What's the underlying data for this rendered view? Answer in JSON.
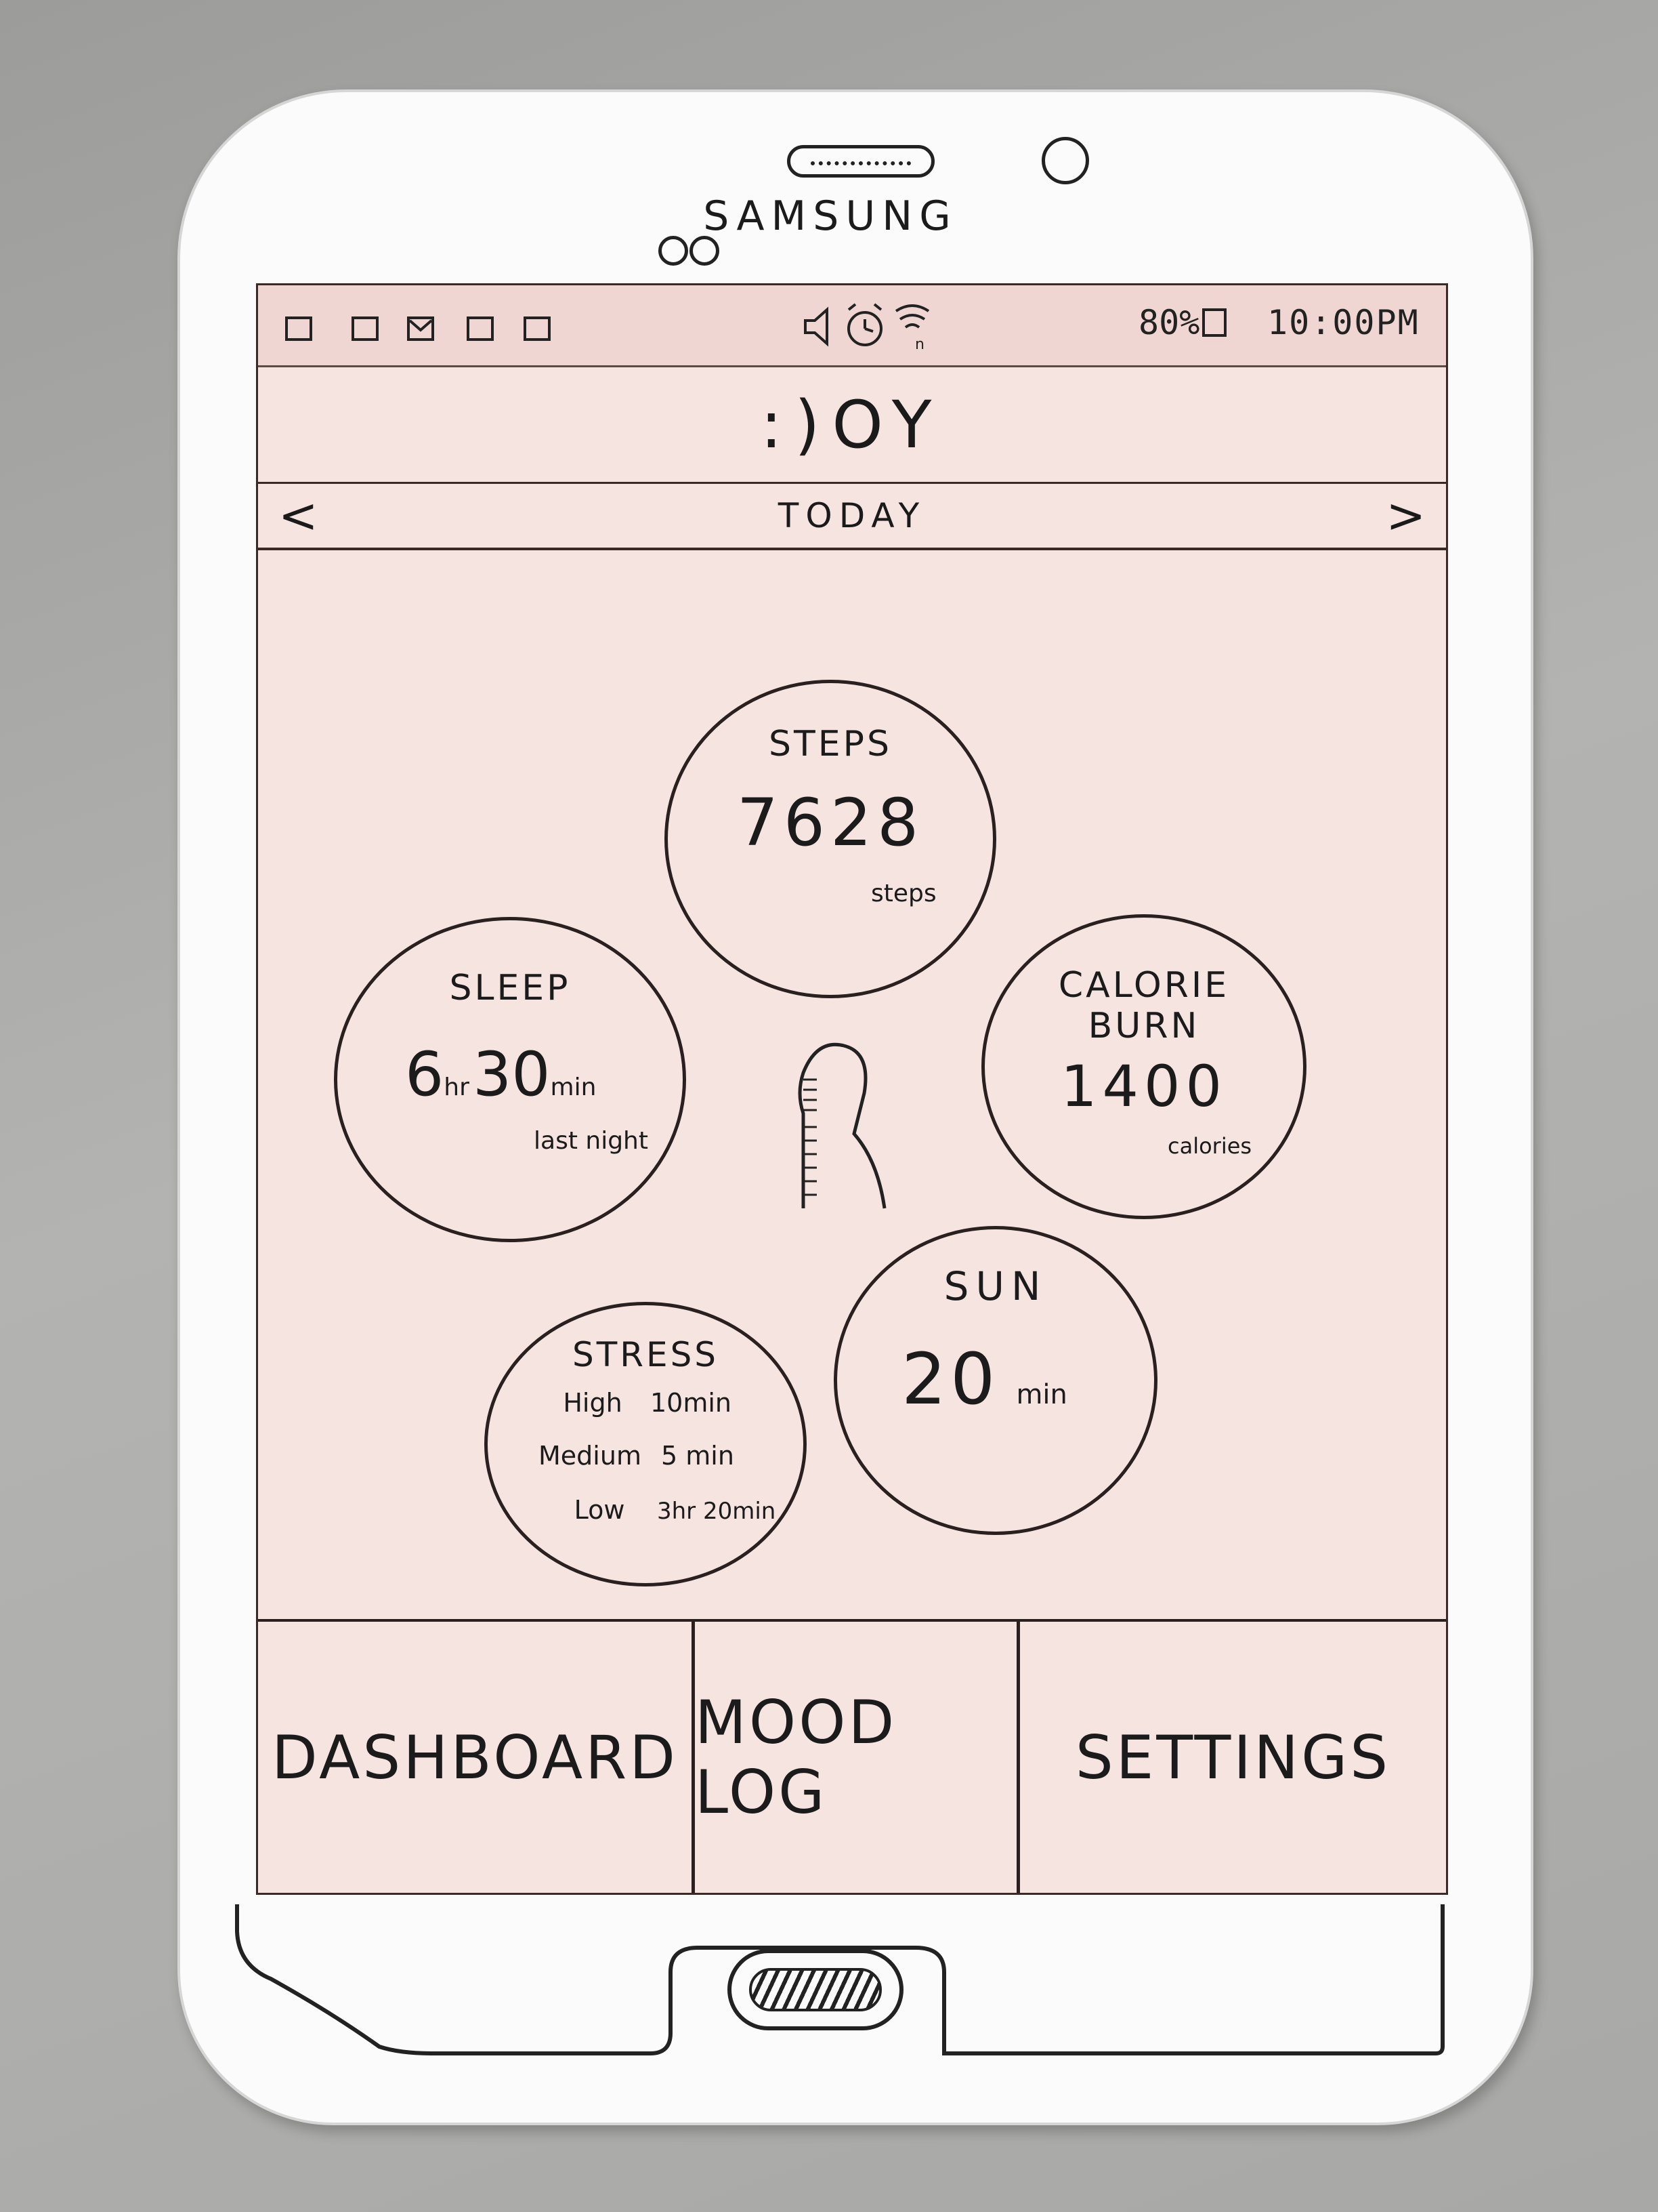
{
  "device": {
    "brand": "SAMSUNG"
  },
  "status_bar": {
    "left_icons": [
      "notification-square-icon",
      "notification-square-icon",
      "mail-icon",
      "notification-square-icon",
      "notification-square-icon"
    ],
    "center_icons": [
      "speaker-icon",
      "alarm-icon",
      "wifi-icon"
    ],
    "battery": "80%",
    "time": "10:00PM"
  },
  "app": {
    "title": ":)OY"
  },
  "date_nav": {
    "label": "TODAY",
    "prev": "<",
    "next": ">"
  },
  "metrics": {
    "steps": {
      "title": "STEPS",
      "value": "7628",
      "unit": "steps"
    },
    "sleep": {
      "title": "SLEEP",
      "hours": "6",
      "hours_unit": "hr",
      "minutes": "30",
      "minutes_unit": "min",
      "note": "last night"
    },
    "calorie": {
      "title_line1": "CALORIE",
      "title_line2": "BURN",
      "value": "1400",
      "unit": "calories"
    },
    "sun": {
      "title": "SUN",
      "value": "20",
      "unit": "min"
    },
    "stress": {
      "title": "STRESS",
      "rows": [
        {
          "level": "High",
          "time": "10min"
        },
        {
          "level": "Medium",
          "time": "5 min"
        },
        {
          "level": "Low",
          "time": "3hr 20min"
        }
      ]
    }
  },
  "tabs": [
    {
      "label": "DASHBOARD"
    },
    {
      "label": "MOOD LOG"
    },
    {
      "label": "SETTINGS"
    }
  ]
}
